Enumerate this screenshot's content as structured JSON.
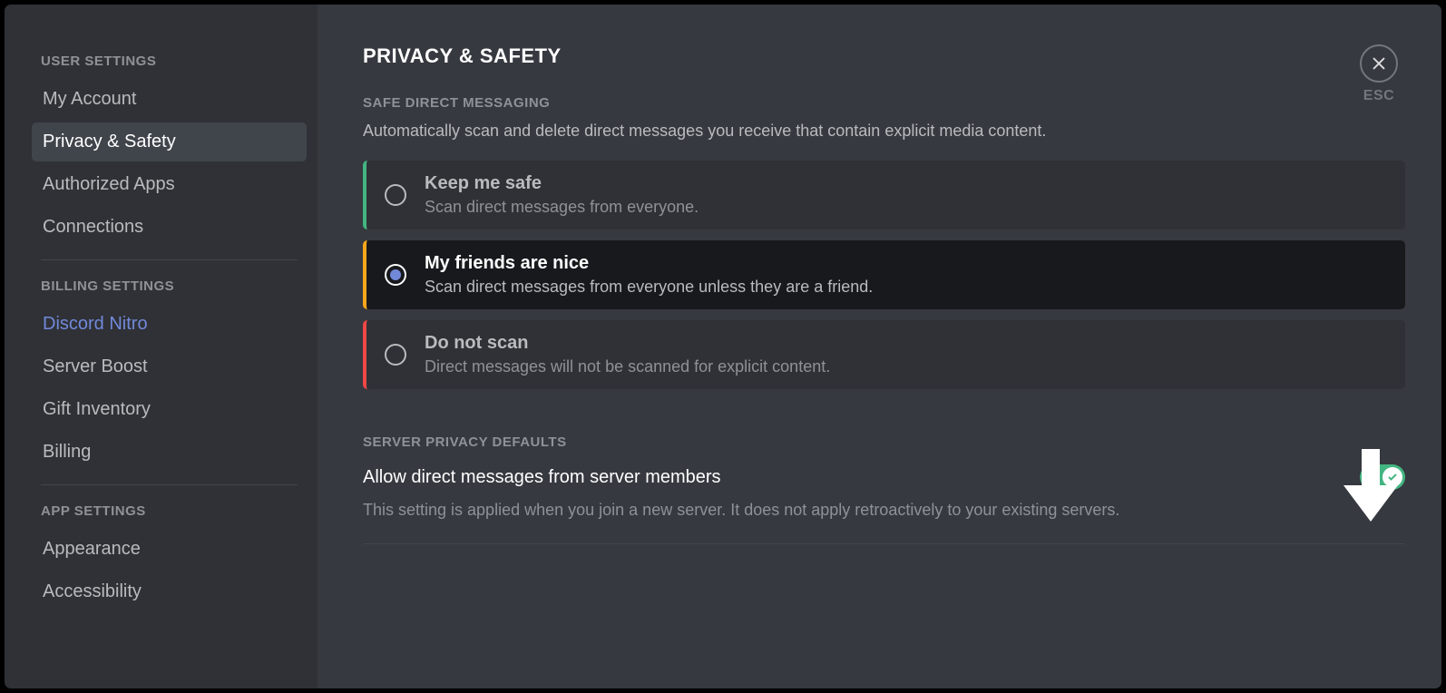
{
  "sidebar": {
    "sections": [
      {
        "header": "USER SETTINGS",
        "items": [
          {
            "label": "My Account",
            "active": false
          },
          {
            "label": "Privacy & Safety",
            "active": true
          },
          {
            "label": "Authorized Apps",
            "active": false
          },
          {
            "label": "Connections",
            "active": false
          }
        ]
      },
      {
        "header": "BILLING SETTINGS",
        "items": [
          {
            "label": "Discord Nitro",
            "active": false,
            "nitro": true
          },
          {
            "label": "Server Boost",
            "active": false
          },
          {
            "label": "Gift Inventory",
            "active": false
          },
          {
            "label": "Billing",
            "active": false
          }
        ]
      },
      {
        "header": "APP SETTINGS",
        "items": [
          {
            "label": "Appearance",
            "active": false
          },
          {
            "label": "Accessibility",
            "active": false
          }
        ]
      }
    ]
  },
  "page": {
    "title": "PRIVACY & SAFETY",
    "close_label": "ESC"
  },
  "safe_dm": {
    "header": "SAFE DIRECT MESSAGING",
    "description": "Automatically scan and delete direct messages you receive that contain explicit media content.",
    "options": [
      {
        "title": "Keep me safe",
        "desc": "Scan direct messages from everyone.",
        "accent": "green",
        "selected": false
      },
      {
        "title": "My friends are nice",
        "desc": "Scan direct messages from everyone unless they are a friend.",
        "accent": "yellow",
        "selected": true
      },
      {
        "title": "Do not scan",
        "desc": "Direct messages will not be scanned for explicit content.",
        "accent": "red",
        "selected": false
      }
    ]
  },
  "server_privacy": {
    "header": "SERVER PRIVACY DEFAULTS",
    "toggle_title": "Allow direct messages from server members",
    "toggle_desc": "This setting is applied when you join a new server. It does not apply retroactively to your existing servers.",
    "toggle_on": true
  }
}
